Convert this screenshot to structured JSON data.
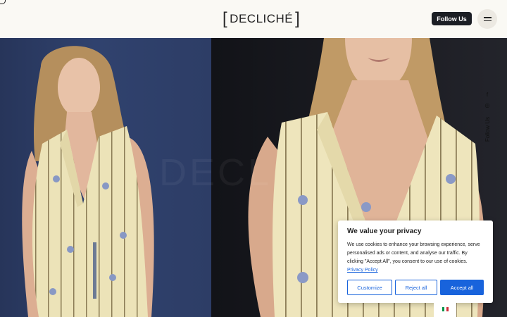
{
  "header": {
    "logo_text": "DECLICHÉ",
    "logo_bracket_left": "[",
    "logo_bracket_right": "]",
    "follow_label": "Follow Us",
    "menu_icon": "hamburger-icon"
  },
  "hero": {
    "watermark_text": "DECL",
    "left_image_description_icon": "model-photo",
    "right_image_description_icon": "model-photo"
  },
  "side_social": {
    "icons": [
      "facebook-icon",
      "instagram-icon"
    ],
    "label": "Follow Us"
  },
  "cookie_banner": {
    "title": "We value your privacy",
    "body": "We use cookies to enhance your browsing experience, serve personalised ads or content, and analyse our traffic. By clicking \"Accept All\", you consent to our use of cookies.",
    "policy_link": "Privacy Policy",
    "customize_label": "Customize",
    "reject_label": "Reject all",
    "accept_label": "Accept all",
    "accent_color": "#1863dc"
  },
  "language": {
    "flag": "italy-flag-icon"
  }
}
